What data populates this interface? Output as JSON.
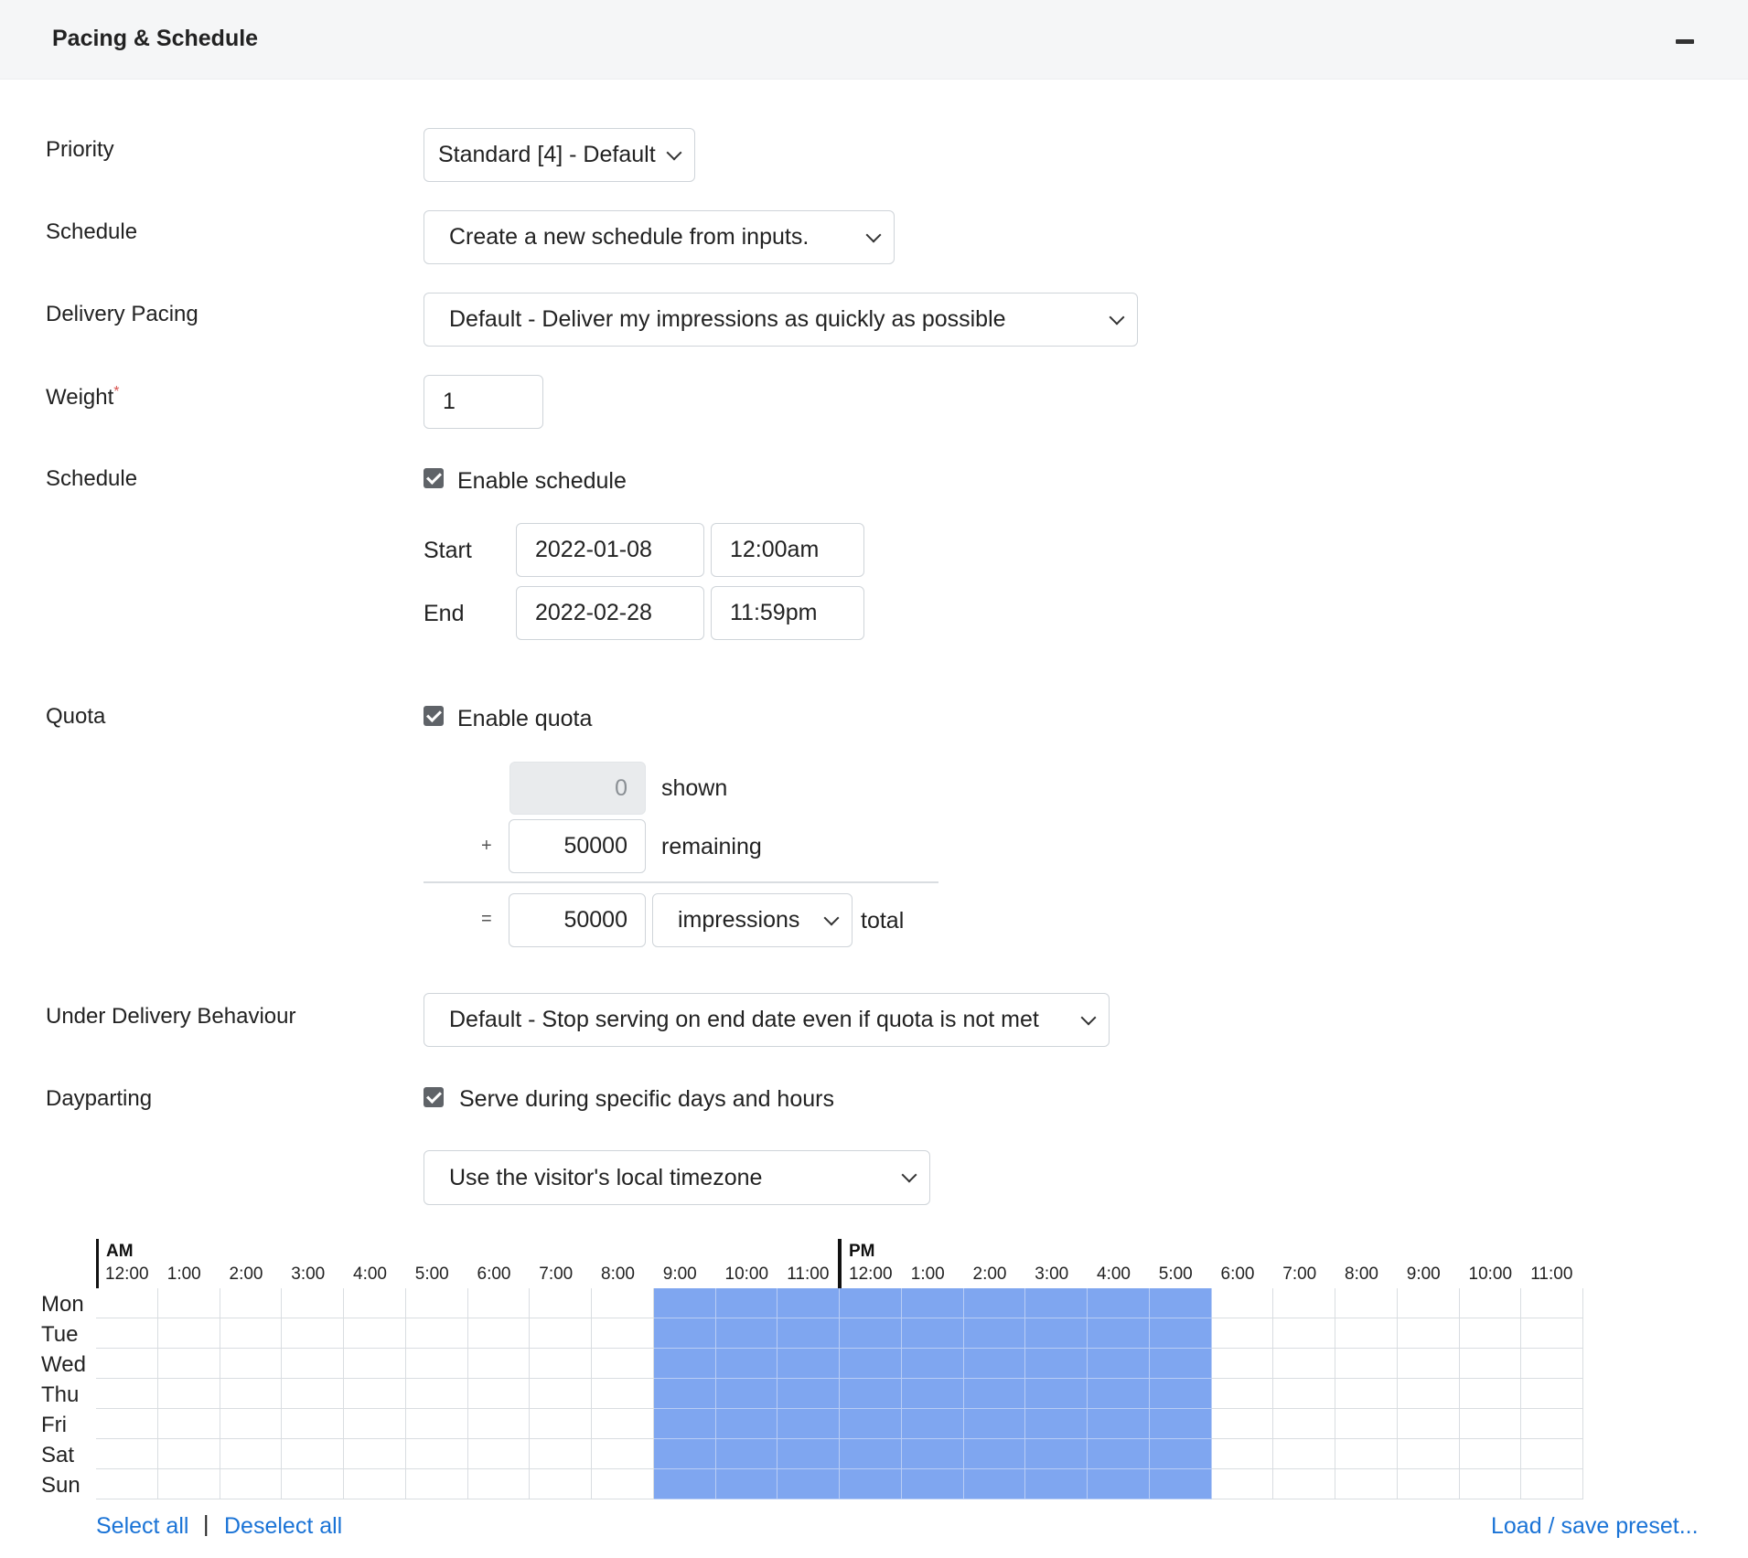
{
  "panel": {
    "title": "Pacing & Schedule"
  },
  "priority": {
    "label": "Priority",
    "value": "Standard [4] - Default"
  },
  "schedule_select": {
    "label": "Schedule",
    "value": "Create a new schedule from inputs."
  },
  "delivery_pacing": {
    "label": "Delivery Pacing",
    "value": "Default - Deliver my impressions as quickly as possible"
  },
  "weight": {
    "label": "Weight",
    "required_mark": "*",
    "value": "1"
  },
  "schedule": {
    "label": "Schedule",
    "enable_label": "Enable schedule",
    "enabled": true,
    "start_label": "Start",
    "start_date": "2022-01-08",
    "start_time": "12:00am",
    "end_label": "End",
    "end_date": "2022-02-28",
    "end_time": "11:59pm"
  },
  "quota": {
    "label": "Quota",
    "enable_label": "Enable quota",
    "enabled": true,
    "shown_value": "0",
    "shown_label": "shown",
    "plus": "+",
    "remaining_value": "50000",
    "remaining_label": "remaining",
    "equals": "=",
    "total_value": "50000",
    "unit": "impressions",
    "total_label": "total"
  },
  "under_delivery": {
    "label": "Under Delivery Behaviour",
    "value": "Default - Stop serving on end date even if quota is not met"
  },
  "dayparting": {
    "label": "Dayparting",
    "enable_label": "Serve during specific days and hours",
    "enabled": true,
    "timezone": "Use the visitor's local timezone",
    "am_label": "AM",
    "pm_label": "PM",
    "hours": [
      "12:00",
      "1:00",
      "2:00",
      "3:00",
      "4:00",
      "5:00",
      "6:00",
      "7:00",
      "8:00",
      "9:00",
      "10:00",
      "11:00",
      "12:00",
      "1:00",
      "2:00",
      "3:00",
      "4:00",
      "5:00",
      "6:00",
      "7:00",
      "8:00",
      "9:00",
      "10:00",
      "11:00"
    ],
    "days": [
      "Mon",
      "Tue",
      "Wed",
      "Thu",
      "Fri",
      "Sat",
      "Sun"
    ],
    "selected_hours_24h": [
      9,
      10,
      11,
      12,
      13,
      14,
      15,
      16,
      17
    ],
    "selected_color": "#7fa6f0",
    "select_all": "Select all",
    "separator": "|",
    "deselect_all": "Deselect all",
    "preset_link": "Load / save preset..."
  }
}
